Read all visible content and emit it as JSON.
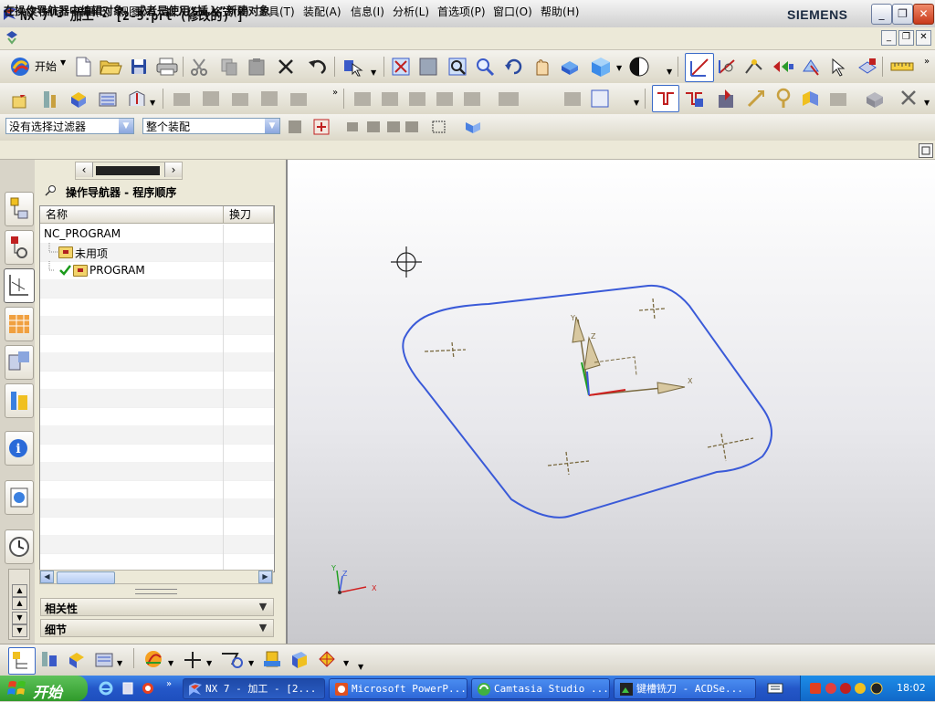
{
  "window": {
    "title": "NX 7 - 加工 - [2-5.prt (修改的) ]",
    "brand": "SIEMENS",
    "buttons": {
      "minimize": "_",
      "restore": "❐",
      "close": "✕"
    }
  },
  "menu": {
    "items": [
      "文件(F)",
      "编辑(E)",
      "视图(V)",
      "插入(S)",
      "格式(R)",
      "工具(T)",
      "装配(A)",
      "信息(I)",
      "分析(L)",
      "首选项(P)",
      "窗口(O)",
      "帮助(H)"
    ]
  },
  "toolbar": {
    "start_label": "开始"
  },
  "filter": {
    "selection_filter": "没有选择过滤器",
    "assembly_scope": "整个装配"
  },
  "status": {
    "prompt": "在操作导航器中编辑对象，或者是使用“插入”新建对象"
  },
  "navigator": {
    "title": "操作导航器 - 程序顺序",
    "columns": [
      "名称",
      "换刀"
    ],
    "rows": [
      {
        "name": "NC_PROGRAM"
      },
      {
        "name": "未用项"
      },
      {
        "name": "PROGRAM"
      }
    ],
    "sections": [
      "相关性",
      "细节"
    ]
  },
  "graphics": {
    "triad_labels": {
      "x": "X",
      "y": "Y",
      "z": "Z"
    },
    "outline_color": "#3a5ad8"
  },
  "taskbar": {
    "start_label": "开始",
    "tasks": [
      "NX 7 - 加工 - [2...",
      "Microsoft PowerP...",
      "Camtasia Studio ...",
      "键槽铣刀 - ACDSe..."
    ],
    "clock": "18:02"
  },
  "colors": {
    "taskbar_blue": "#2457c8",
    "start_green": "#2f9a2a",
    "check_green": "#1a9a1a"
  }
}
